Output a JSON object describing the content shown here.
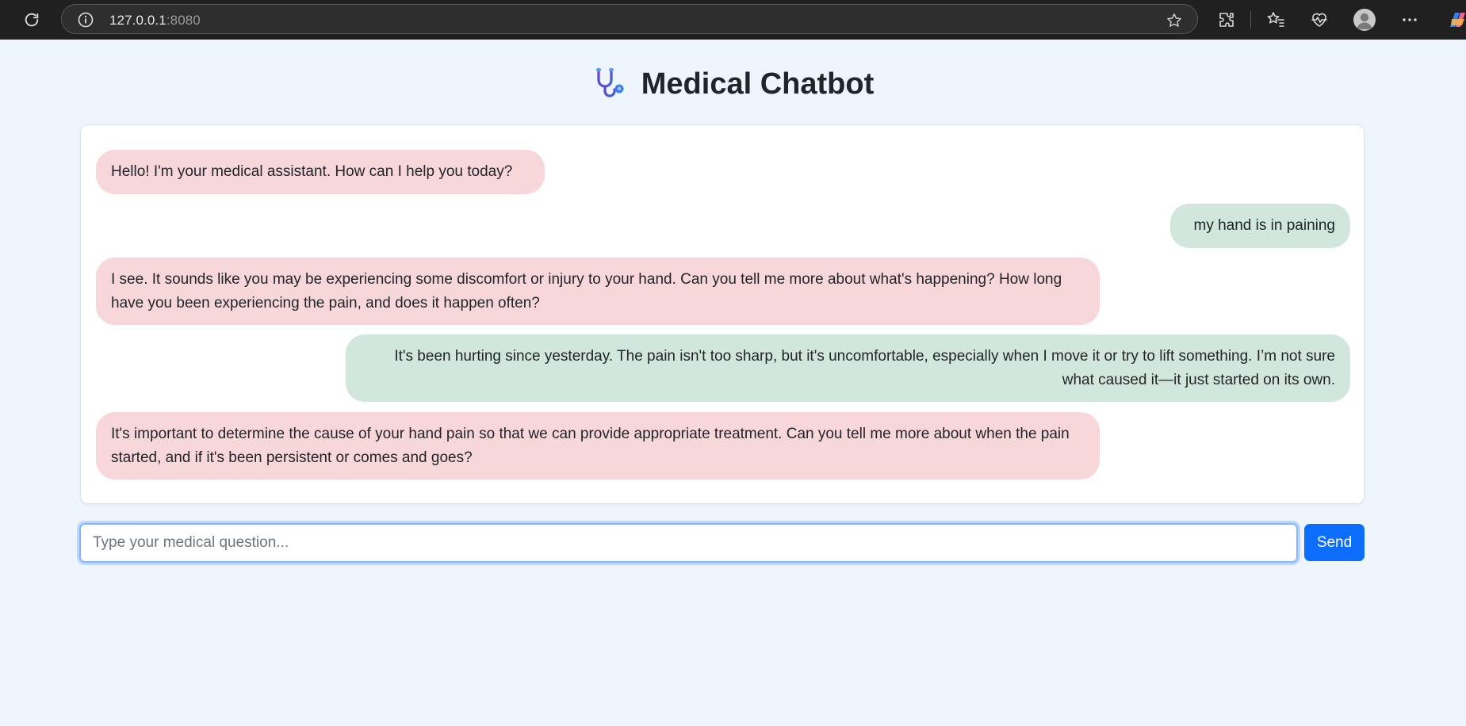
{
  "browser": {
    "url_host": "127.0.0.1",
    "url_port": ":8080",
    "icons": [
      "reload-icon",
      "site-info-icon",
      "favorite-star-icon",
      "extensions-icon",
      "favorites-icon",
      "health-icon",
      "profile-avatar",
      "more-icon",
      "copilot-icon"
    ]
  },
  "page": {
    "title": "Medical Chatbot",
    "title_icon": "stethoscope-icon"
  },
  "messages": [
    {
      "role": "bot",
      "text": "Hello! I'm your medical assistant. How can I help you today?"
    },
    {
      "role": "user",
      "text": "my hand is in paining"
    },
    {
      "role": "bot",
      "text": "I see. It sounds like you may be experiencing some discomfort or injury to your hand. Can you tell me more about what's happening? How long have you been experiencing the pain, and does it happen often?"
    },
    {
      "role": "user",
      "text": "It's been hurting since yesterday. The pain isn't too sharp, but it's uncomfortable, especially when I move it or try to lift something. I’m not sure what caused it—it just started on its own."
    },
    {
      "role": "bot",
      "text": "It's important to determine the cause of your hand pain so that we can provide appropriate treatment. Can you tell me more about when the pain started, and if it's been persistent or comes and goes?"
    }
  ],
  "composer": {
    "placeholder": "Type your medical question...",
    "value": "",
    "send_label": "Send"
  },
  "colors": {
    "bot_bubble": "#f8d7da",
    "user_bubble": "#d1e7dd",
    "accent": "#0d6efd",
    "page_background": "#eef5fd"
  }
}
